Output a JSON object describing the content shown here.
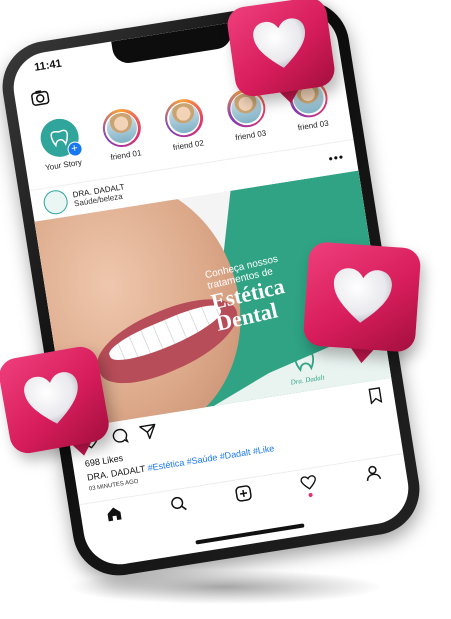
{
  "status": {
    "time": "11:41"
  },
  "stories": [
    {
      "label": "Your Story",
      "own": true
    },
    {
      "label": "friend 01"
    },
    {
      "label": "friend 02"
    },
    {
      "label": "friend 03"
    },
    {
      "label": "friend 03"
    }
  ],
  "post": {
    "account": "DRA. DADALT",
    "subtitle": "Saúde/beleza",
    "image_text": {
      "line1": "Conheça nossos",
      "line2": "tratamentos de",
      "big1": "Estética",
      "big2": "Dental",
      "logo": "Dra. Dadalt"
    },
    "likes": "698 Likes",
    "caption_user": "DRA. DADALT",
    "hashtags": "#Estética #Saúde #Dadalt #Like",
    "time": "03 MINUTES AGO"
  },
  "colors": {
    "accent_pink": "#e1306c",
    "teal": "#2fa384",
    "hashtag_blue": "#1877f2"
  },
  "icons": {
    "top_left": "camera-icon",
    "top_right": "igtv-icon",
    "nav": [
      "home-icon",
      "search-icon",
      "add-post-icon",
      "heart-icon",
      "profile-icon"
    ]
  }
}
